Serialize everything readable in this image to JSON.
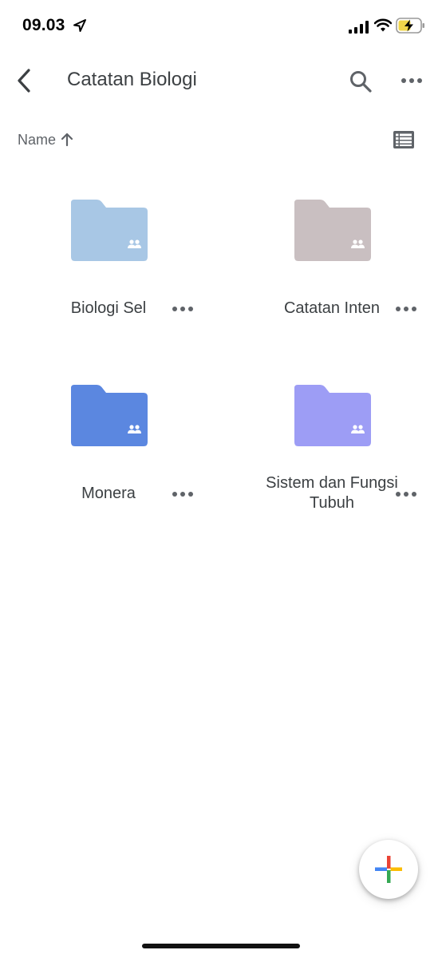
{
  "status_bar": {
    "time": "09.03"
  },
  "header": {
    "title": "Catatan Biologi"
  },
  "sort": {
    "label": "Name",
    "direction": "ascending"
  },
  "folders": [
    {
      "name": "Biologi Sel",
      "color": "#a8c7e5",
      "shared": true
    },
    {
      "name": "Catatan Inten",
      "color": "#c9bfc1",
      "shared": true
    },
    {
      "name": "Monera",
      "color": "#5b87e0",
      "shared": true
    },
    {
      "name": "Sistem dan Fungsi Tubuh",
      "color": "#9d9df5",
      "shared": true
    }
  ],
  "icons": {
    "back": "chevron-left-icon",
    "search": "search-icon",
    "more": "more-horizontal-icon",
    "view": "list-view-icon",
    "fab": "plus-icon"
  },
  "colors": {
    "fab_plus": [
      "#ea4335",
      "#fbbc04",
      "#34a853",
      "#4285f4"
    ]
  }
}
